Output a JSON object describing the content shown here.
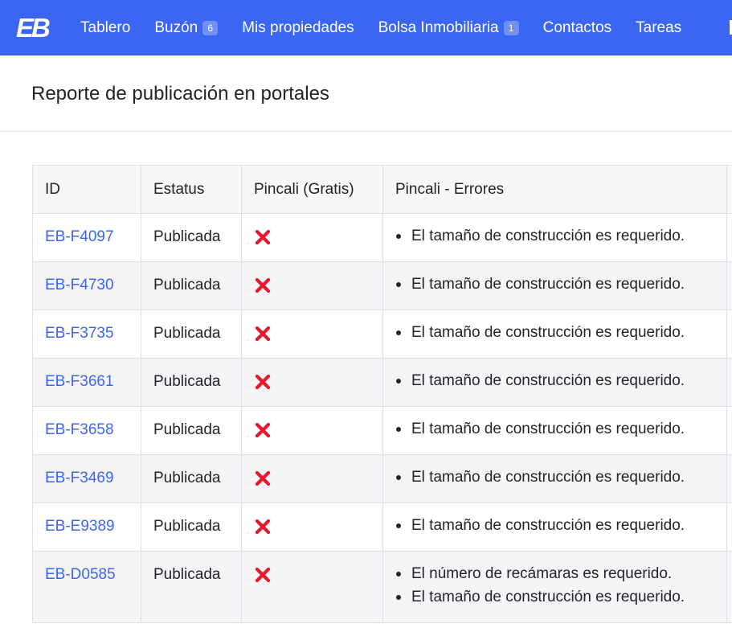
{
  "navbar": {
    "logo_text": "EB",
    "items": [
      {
        "label": "Tablero",
        "badge": null
      },
      {
        "label": "Buzón",
        "badge": "6"
      },
      {
        "label": "Mis propiedades",
        "badge": null
      },
      {
        "label": "Bolsa Inmobiliaria",
        "badge": "1"
      },
      {
        "label": "Contactos",
        "badge": null
      },
      {
        "label": "Tareas",
        "badge": null
      }
    ],
    "colors": {
      "background": "#3b66f3",
      "text": "#ffffff"
    }
  },
  "page": {
    "title": "Reporte de publicación en portales"
  },
  "table": {
    "headers": [
      "ID",
      "Estatus",
      "Pincali (Gratis)",
      "Pincali - Errores"
    ],
    "rows": [
      {
        "id": "EB-F4097",
        "status": "Publicada",
        "pincali_icon": "red-x-icon",
        "errors": [
          "El tamaño de construcción es requerido."
        ]
      },
      {
        "id": "EB-F4730",
        "status": "Publicada",
        "pincali_icon": "red-x-icon",
        "errors": [
          "El tamaño de construcción es requerido."
        ]
      },
      {
        "id": "EB-F3735",
        "status": "Publicada",
        "pincali_icon": "red-x-icon",
        "errors": [
          "El tamaño de construcción es requerido."
        ]
      },
      {
        "id": "EB-F3661",
        "status": "Publicada",
        "pincali_icon": "red-x-icon",
        "errors": [
          "El tamaño de construcción es requerido."
        ]
      },
      {
        "id": "EB-F3658",
        "status": "Publicada",
        "pincali_icon": "red-x-icon",
        "errors": [
          "El tamaño de construcción es requerido."
        ]
      },
      {
        "id": "EB-F3469",
        "status": "Publicada",
        "pincali_icon": "red-x-icon",
        "errors": [
          "El tamaño de construcción es requerido."
        ]
      },
      {
        "id": "EB-E9389",
        "status": "Publicada",
        "pincali_icon": "red-x-icon",
        "errors": [
          "El tamaño de construcción es requerido."
        ]
      },
      {
        "id": "EB-D0585",
        "status": "Publicada",
        "pincali_icon": "red-x-icon",
        "errors": [
          "El número de recámaras es requerido.",
          "El tamaño de construcción es requerido."
        ]
      }
    ],
    "colors": {
      "link": "#3b66f3",
      "error_icon": "#e8192c"
    }
  }
}
